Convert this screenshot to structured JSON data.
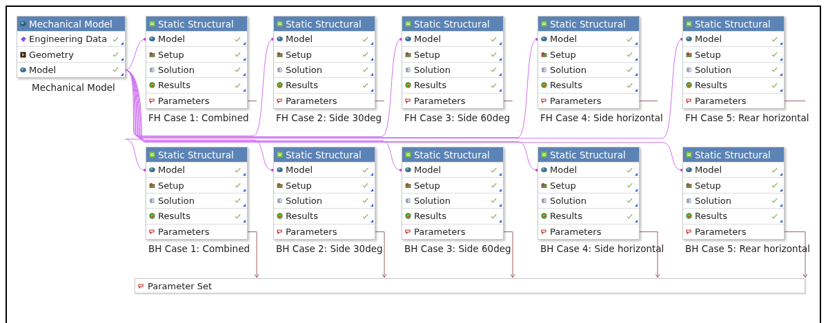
{
  "source_system": {
    "title": "Mechanical Model",
    "caption": "Mechanical Model",
    "rows": [
      {
        "kind": "engineering-data",
        "label": "Engineering Data",
        "checked": true
      },
      {
        "kind": "geometry",
        "label": "Geometry",
        "checked": true
      },
      {
        "kind": "model",
        "label": "Model",
        "checked": true
      }
    ]
  },
  "systems": [
    {
      "title": "Static Structural",
      "caption": "FH Case 1: Combined",
      "rows": [
        {
          "kind": "model",
          "label": "Model",
          "checked": true
        },
        {
          "kind": "setup",
          "label": "Setup",
          "checked": true
        },
        {
          "kind": "solution",
          "label": "Solution",
          "checked": true
        },
        {
          "kind": "results",
          "label": "Results",
          "checked": true
        },
        {
          "kind": "parameters",
          "label": "Parameters",
          "checked": false
        }
      ]
    },
    {
      "title": "Static Structural",
      "caption": "FH Case 2: Side 30deg",
      "rows": [
        {
          "kind": "model",
          "label": "Model",
          "checked": true
        },
        {
          "kind": "setup",
          "label": "Setup",
          "checked": true
        },
        {
          "kind": "solution",
          "label": "Solution",
          "checked": true
        },
        {
          "kind": "results",
          "label": "Results",
          "checked": true
        },
        {
          "kind": "parameters",
          "label": "Parameters",
          "checked": false
        }
      ]
    },
    {
      "title": "Static Structural",
      "caption": "FH Case 3: Side 60deg",
      "rows": [
        {
          "kind": "model",
          "label": "Model",
          "checked": true
        },
        {
          "kind": "setup",
          "label": "Setup",
          "checked": true
        },
        {
          "kind": "solution",
          "label": "Solution",
          "checked": true
        },
        {
          "kind": "results",
          "label": "Results",
          "checked": true
        },
        {
          "kind": "parameters",
          "label": "Parameters",
          "checked": false
        }
      ]
    },
    {
      "title": "Static Structural",
      "caption": "FH Case 4: Side horizontal",
      "rows": [
        {
          "kind": "model",
          "label": "Model",
          "checked": true
        },
        {
          "kind": "setup",
          "label": "Setup",
          "checked": true
        },
        {
          "kind": "solution",
          "label": "Solution",
          "checked": true
        },
        {
          "kind": "results",
          "label": "Results",
          "checked": true
        },
        {
          "kind": "parameters",
          "label": "Parameters",
          "checked": false
        }
      ]
    },
    {
      "title": "Static Structural",
      "caption": "FH Case 5: Rear horizontal",
      "rows": [
        {
          "kind": "model",
          "label": "Model",
          "checked": true
        },
        {
          "kind": "setup",
          "label": "Setup",
          "checked": true
        },
        {
          "kind": "solution",
          "label": "Solution",
          "checked": true
        },
        {
          "kind": "results",
          "label": "Results",
          "checked": true
        },
        {
          "kind": "parameters",
          "label": "Parameters",
          "checked": false
        }
      ]
    },
    {
      "title": "Static Structural",
      "caption": "BH Case 1: Combined",
      "rows": [
        {
          "kind": "model",
          "label": "Model",
          "checked": true
        },
        {
          "kind": "setup",
          "label": "Setup",
          "checked": true
        },
        {
          "kind": "solution",
          "label": "Solution",
          "checked": true
        },
        {
          "kind": "results",
          "label": "Results",
          "checked": true
        },
        {
          "kind": "parameters",
          "label": "Parameters",
          "checked": false
        }
      ]
    },
    {
      "title": "Static Structural",
      "caption": "BH Case 2: Side 30deg",
      "rows": [
        {
          "kind": "model",
          "label": "Model",
          "checked": true
        },
        {
          "kind": "setup",
          "label": "Setup",
          "checked": true
        },
        {
          "kind": "solution",
          "label": "Solution",
          "checked": true
        },
        {
          "kind": "results",
          "label": "Results",
          "checked": true
        },
        {
          "kind": "parameters",
          "label": "Parameters",
          "checked": false
        }
      ]
    },
    {
      "title": "Static Structural",
      "caption": "BH Case 3: Side 60deg",
      "rows": [
        {
          "kind": "model",
          "label": "Model",
          "checked": true
        },
        {
          "kind": "setup",
          "label": "Setup",
          "checked": true
        },
        {
          "kind": "solution",
          "label": "Solution",
          "checked": true
        },
        {
          "kind": "results",
          "label": "Results",
          "checked": true
        },
        {
          "kind": "parameters",
          "label": "Parameters",
          "checked": false
        }
      ]
    },
    {
      "title": "Static Structural",
      "caption": "BH Case 4: Side horizontal",
      "rows": [
        {
          "kind": "model",
          "label": "Model",
          "checked": true
        },
        {
          "kind": "setup",
          "label": "Setup",
          "checked": true
        },
        {
          "kind": "solution",
          "label": "Solution",
          "checked": true
        },
        {
          "kind": "results",
          "label": "Results",
          "checked": true
        },
        {
          "kind": "parameters",
          "label": "Parameters",
          "checked": false
        }
      ]
    },
    {
      "title": "Static Structural",
      "caption": "BH Case 5: Rear horizontal",
      "rows": [
        {
          "kind": "model",
          "label": "Model",
          "checked": true
        },
        {
          "kind": "setup",
          "label": "Setup",
          "checked": true
        },
        {
          "kind": "solution",
          "label": "Solution",
          "checked": true
        },
        {
          "kind": "results",
          "label": "Results",
          "checked": true
        },
        {
          "kind": "parameters",
          "label": "Parameters",
          "checked": false
        }
      ]
    }
  ],
  "parameter_set": {
    "label": "Parameter Set"
  }
}
